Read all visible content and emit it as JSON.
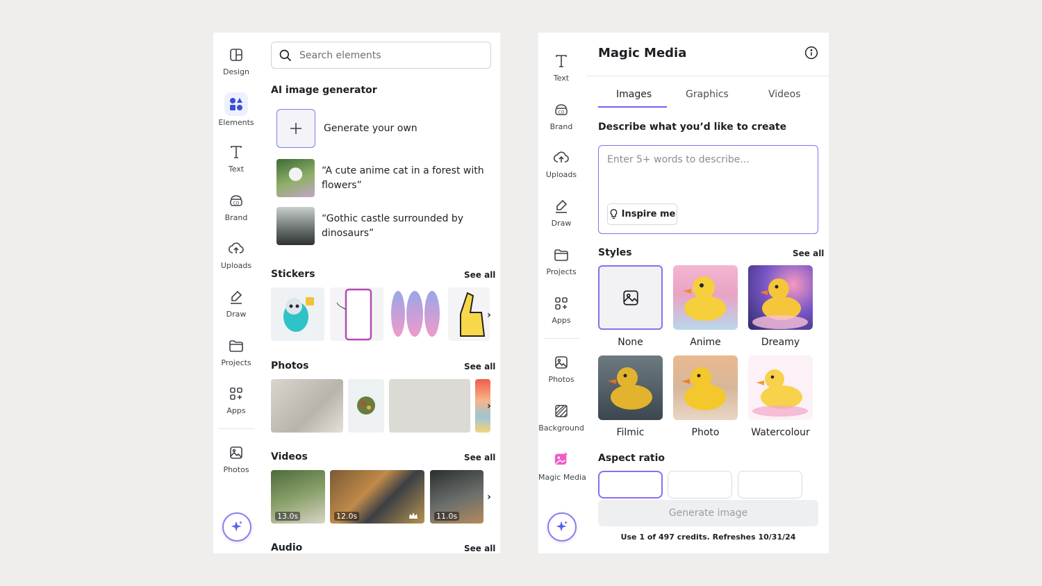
{
  "left_panel": {
    "rail": [
      {
        "label": "Design",
        "icon": "design-icon"
      },
      {
        "label": "Elements",
        "icon": "elements-icon",
        "active": true
      },
      {
        "label": "Text",
        "icon": "text-icon"
      },
      {
        "label": "Brand",
        "icon": "brand-icon"
      },
      {
        "label": "Uploads",
        "icon": "upload-cloud-icon"
      },
      {
        "label": "Draw",
        "icon": "draw-icon"
      },
      {
        "label": "Projects",
        "icon": "folder-icon"
      },
      {
        "label": "Apps",
        "icon": "apps-icon"
      },
      {
        "label": "Photos",
        "icon": "photos-icon"
      }
    ],
    "search_placeholder": "Search elements",
    "ai_section": {
      "title": "AI image generator",
      "generate_label": "Generate your own",
      "prompts": [
        {
          "line1": "“A cute anime cat in a forest with",
          "line2": "flowers”"
        },
        {
          "line1": "“Gothic castle surrounded by",
          "line2": "dinosaurs”"
        }
      ]
    },
    "stickers": {
      "title": "Stickers",
      "see_all": "See all"
    },
    "photos": {
      "title": "Photos",
      "see_all": "See all"
    },
    "videos": {
      "title": "Videos",
      "see_all": "See all",
      "durations": [
        "13.0s",
        "12.0s",
        "11.0s"
      ]
    },
    "audio": {
      "title": "Audio",
      "see_all": "See all"
    }
  },
  "right_panel": {
    "rail": [
      {
        "label": "Text",
        "icon": "text-icon"
      },
      {
        "label": "Brand",
        "icon": "brand-icon"
      },
      {
        "label": "Uploads",
        "icon": "upload-cloud-icon"
      },
      {
        "label": "Draw",
        "icon": "draw-icon"
      },
      {
        "label": "Projects",
        "icon": "folder-icon"
      },
      {
        "label": "Apps",
        "icon": "apps-icon"
      },
      {
        "label": "Photos",
        "icon": "photos-icon"
      },
      {
        "label": "Background",
        "icon": "background-icon"
      },
      {
        "label": "Magic Media",
        "icon": "magic-media-icon",
        "active": true
      }
    ],
    "title": "Magic Media",
    "tabs": [
      "Images",
      "Graphics",
      "Videos"
    ],
    "active_tab": "Images",
    "describe_label": "Describe what you’d like to create",
    "prompt_placeholder": "Enter 5+ words to describe...",
    "inspire_label": "Inspire me",
    "styles_title": "Styles",
    "styles_see_all": "See all",
    "styles": [
      "None",
      "Anime",
      "Dreamy",
      "Filmic",
      "Photo",
      "Watercolour"
    ],
    "aspect_ratio_title": "Aspect ratio",
    "generate_label": "Generate image",
    "credits_text": "Use 1 of 497 credits. Refreshes 10/31/24"
  },
  "colors": {
    "background": "#efeeec",
    "accent": "#7d5cf0",
    "active_chip": "#eef0ff"
  }
}
